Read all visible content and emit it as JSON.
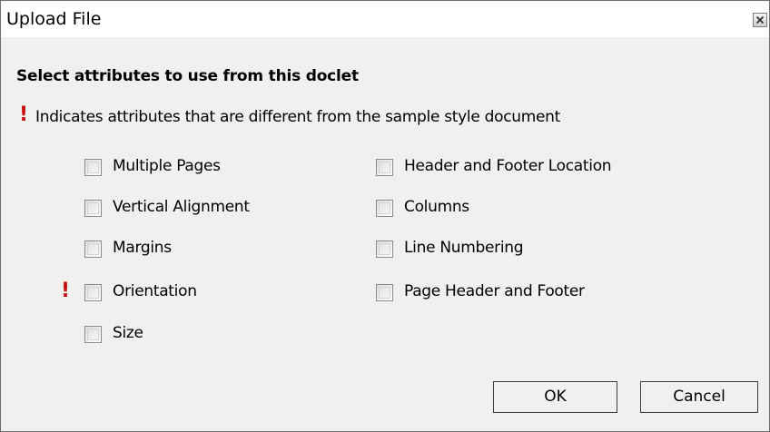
{
  "window": {
    "title": "Upload File",
    "close_icon": "close-icon"
  },
  "heading": "Select attributes to use from this doclet",
  "legend": {
    "marker": "!",
    "text": "Indicates attributes that are different from the sample style document"
  },
  "options_left": [
    {
      "label": "Multiple Pages",
      "checked": false,
      "different": false
    },
    {
      "label": "Vertical Alignment",
      "checked": false,
      "different": false
    },
    {
      "label": "Margins",
      "checked": false,
      "different": false
    },
    {
      "label": "Orientation",
      "checked": false,
      "different": true,
      "marker": "!"
    },
    {
      "label": "Size",
      "checked": false,
      "different": false
    }
  ],
  "options_right": [
    {
      "label": "Header and Footer Location",
      "checked": false,
      "different": false
    },
    {
      "label": "Columns",
      "checked": false,
      "different": false
    },
    {
      "label": "Line Numbering",
      "checked": false,
      "different": false
    },
    {
      "label": "Page Header and Footer",
      "checked": false,
      "different": false
    }
  ],
  "buttons": {
    "ok": "OK",
    "cancel": "Cancel"
  },
  "colors": {
    "marker": "#c81010",
    "dialog_bg": "#f0f0f0",
    "titlebar_bg": "#ffffff"
  }
}
